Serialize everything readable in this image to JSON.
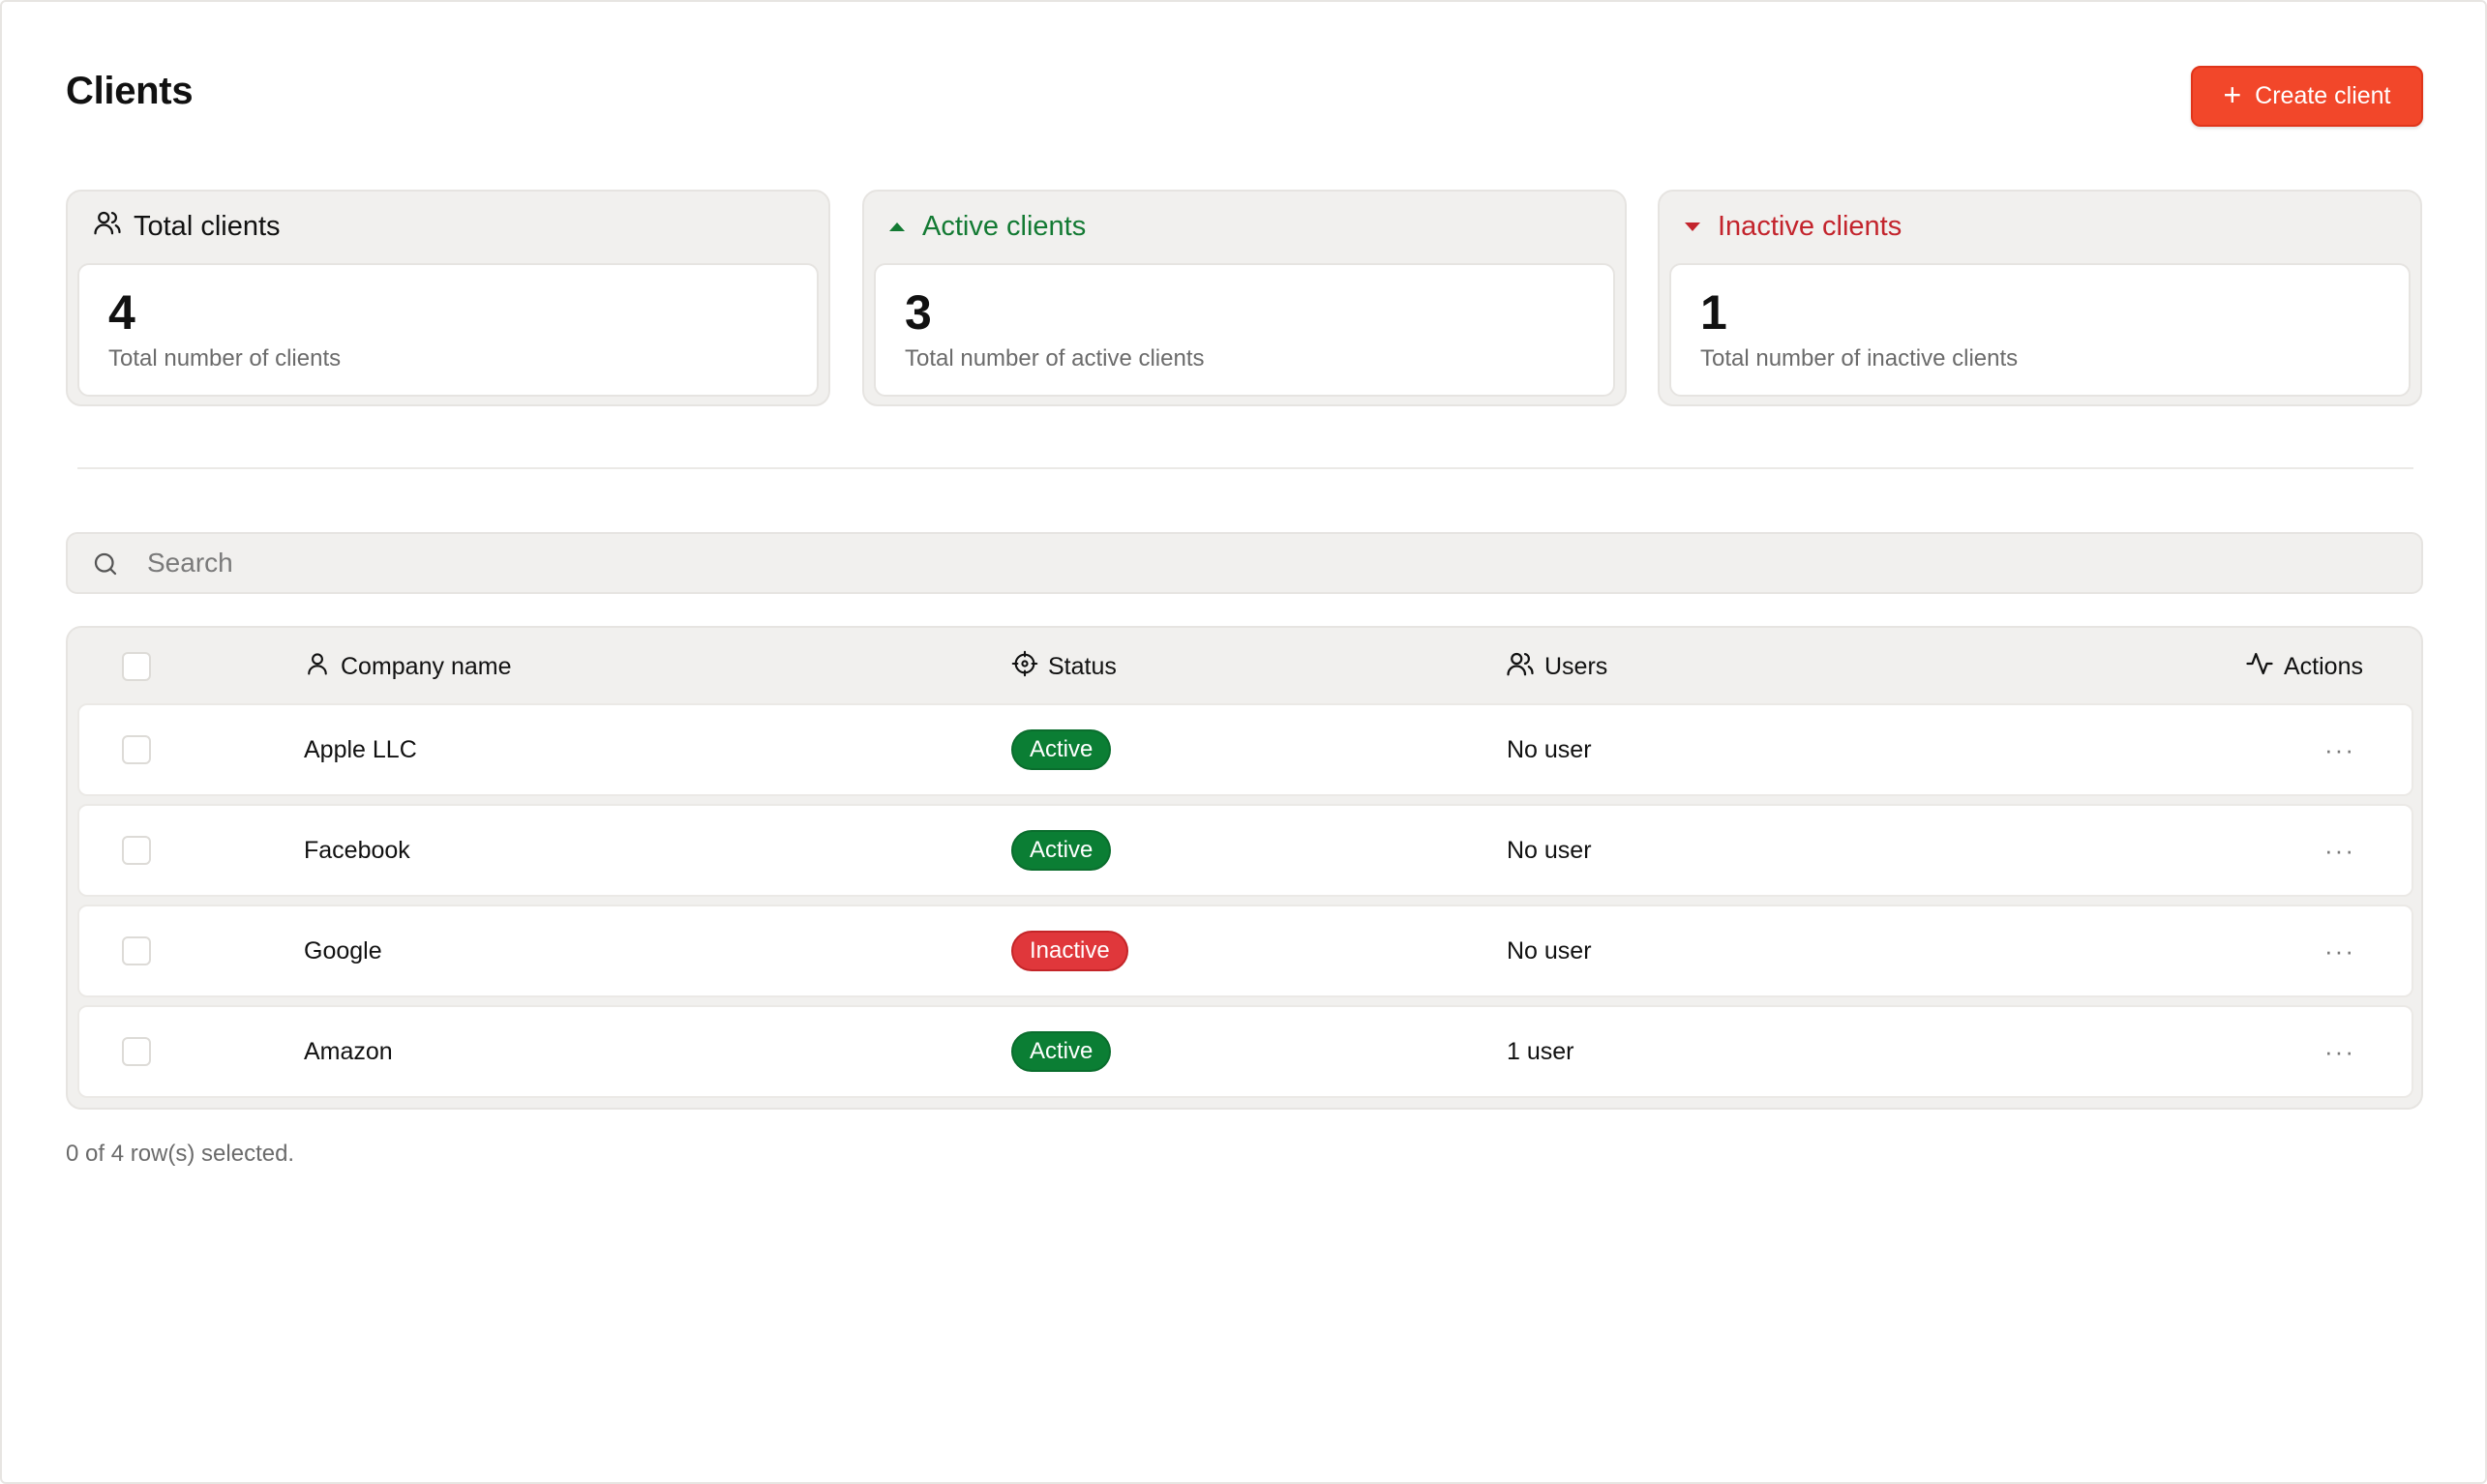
{
  "header": {
    "title": "Clients",
    "create_button": "Create client",
    "create_icon": "plus-icon"
  },
  "stats": {
    "total": {
      "label": "Total clients",
      "value": "4",
      "description": "Total number of clients",
      "icon": "users-icon"
    },
    "active": {
      "label": "Active clients",
      "value": "3",
      "description": "Total number of active clients",
      "icon": "triangle-up-icon",
      "color": "#137a33"
    },
    "inactive": {
      "label": "Inactive clients",
      "value": "1",
      "description": "Total number of inactive clients",
      "icon": "triangle-down-icon",
      "color": "#c3242c"
    }
  },
  "search": {
    "placeholder": "Search",
    "value": "",
    "icon": "search-icon"
  },
  "table": {
    "columns": {
      "company": {
        "label": "Company name",
        "icon": "user-icon"
      },
      "status": {
        "label": "Status",
        "icon": "crosshair-icon"
      },
      "users": {
        "label": "Users",
        "icon": "users-icon"
      },
      "actions": {
        "label": "Actions",
        "icon": "activity-icon"
      }
    },
    "rows": [
      {
        "company": "Apple LLC",
        "status": "Active",
        "users": "No user",
        "actions": "···"
      },
      {
        "company": "Facebook",
        "status": "Active",
        "users": "No user",
        "actions": "···"
      },
      {
        "company": "Google",
        "status": "Inactive",
        "users": "No user",
        "actions": "···"
      },
      {
        "company": "Amazon",
        "status": "Active",
        "users": "1 user",
        "actions": "···"
      }
    ]
  },
  "selection_summary": "0 of 4 row(s) selected.",
  "colors": {
    "brand": "#f2472a",
    "active_badge": "#0b7e34",
    "inactive_badge": "#e0373b"
  }
}
